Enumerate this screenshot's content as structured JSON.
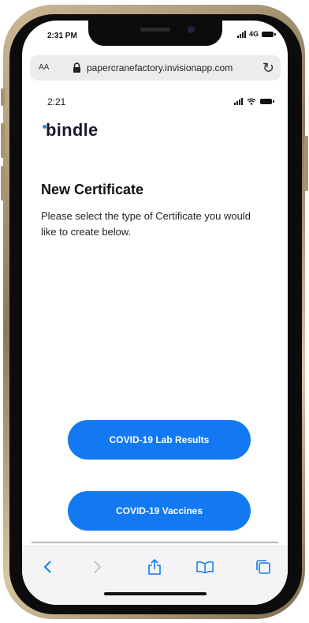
{
  "device": {
    "status_time": "2:31 PM",
    "network": "4G"
  },
  "browser": {
    "text_size_label": "AA",
    "url": "papercranefactory.invisionapp.com",
    "reload_icon": "reload-icon",
    "toolbar": [
      "back-icon",
      "forward-icon",
      "share-icon",
      "bookmarks-icon",
      "tabs-icon"
    ]
  },
  "app": {
    "status_time": "2:21",
    "logo_text": "bindle",
    "brand_color": "#1279f2",
    "title": "New Certificate",
    "description": "Please select the type of Certificate you would like to create below.",
    "buttons": {
      "lab_results": "COVID-19 Lab Results",
      "vaccines": "COVID-19 Vaccines"
    }
  }
}
